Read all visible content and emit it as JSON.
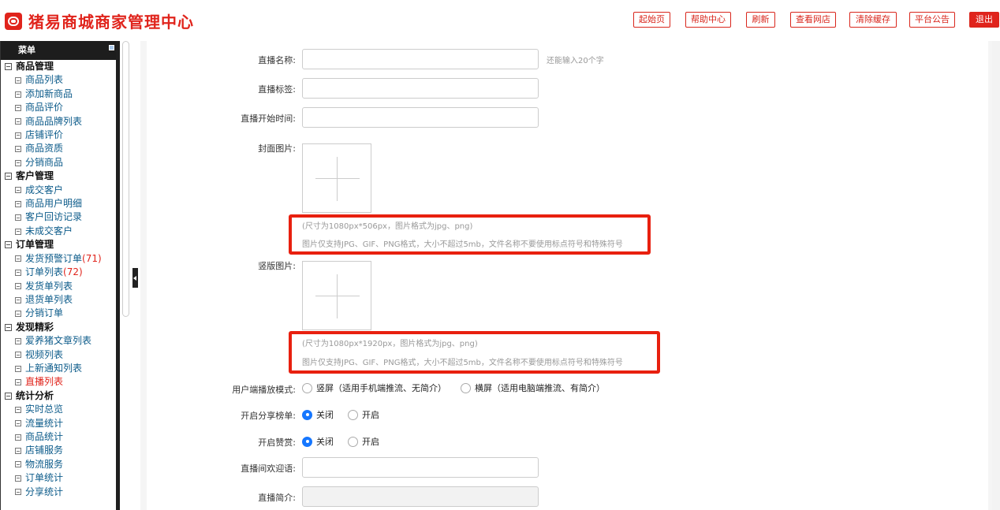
{
  "app": {
    "title": "猪易商城商家管理中心",
    "brand_color": "#e0241c"
  },
  "topnav": {
    "start": "起始页",
    "help": "帮助中心",
    "refresh": "刷新",
    "view_shop": "查看网店",
    "clear_cache": "清除缓存",
    "announcement": "平台公告",
    "logout": "退出"
  },
  "sidebar": {
    "header": "菜单",
    "groups": [
      {
        "title": "商品管理",
        "items": [
          {
            "label": "商品列表"
          },
          {
            "label": "添加新商品"
          },
          {
            "label": "商品评价"
          },
          {
            "label": "商品品牌列表"
          },
          {
            "label": "店铺评价"
          },
          {
            "label": "商品资质"
          },
          {
            "label": "分销商品"
          }
        ]
      },
      {
        "title": "客户管理",
        "items": [
          {
            "label": "成交客户"
          },
          {
            "label": "商品用户明细"
          },
          {
            "label": "客户回访记录"
          },
          {
            "label": "未成交客户"
          }
        ]
      },
      {
        "title": "订单管理",
        "items": [
          {
            "label": "发货预警订单",
            "count": "(71)"
          },
          {
            "label": "订单列表",
            "count": "(72)"
          },
          {
            "label": "发货单列表"
          },
          {
            "label": "退货单列表"
          },
          {
            "label": "分销订单"
          }
        ]
      },
      {
        "title": "发现精彩",
        "items": [
          {
            "label": "爱养猪文章列表"
          },
          {
            "label": "视频列表"
          },
          {
            "label": "上新通知列表"
          },
          {
            "label": "直播列表",
            "active": true
          }
        ]
      },
      {
        "title": "统计分析",
        "items": [
          {
            "label": "实时总览"
          },
          {
            "label": "流量统计"
          },
          {
            "label": "商品统计"
          },
          {
            "label": "店铺服务"
          },
          {
            "label": "物流服务"
          },
          {
            "label": "订单统计"
          },
          {
            "label": "分享统计"
          }
        ]
      }
    ]
  },
  "form": {
    "name_label": "直播名称:",
    "name_value": "",
    "name_hint": "还能输入20个字",
    "tag_label": "直播标签:",
    "tag_value": "",
    "start_label": "直播开始时间:",
    "start_value": "",
    "cover_label": "封面图片:",
    "cover_hint_size": "(尺寸为1080px*506px，图片格式为jpg、png)",
    "cover_hint_rules": "图片仅支持JPG、GIF、PNG格式，大小不超过5mb，文件名称不要使用标点符号和特殊符号",
    "vertical_label": "竖版图片:",
    "vertical_hint_size": "(尺寸为1080px*1920px，图片格式为jpg、png)",
    "vertical_hint_rules": "图片仅支持JPG、GIF、PNG格式，大小不超过5mb，文件名称不要使用标点符号和特殊符号",
    "mode_label": "用户端播放模式:",
    "mode_options": [
      "竖屏（适用手机端推流、无简介）",
      "横屏（适用电脑端推流、有简介）"
    ],
    "mode_selected": null,
    "share_label": "开启分享榜单:",
    "share_options": [
      "关闭",
      "开启"
    ],
    "share_selected": "关闭",
    "reward_label": "开启赞赏:",
    "reward_options": [
      "关闭",
      "开启"
    ],
    "reward_selected": "关闭",
    "welcome_label": "直播间欢迎语:",
    "welcome_value": "",
    "intro_label": "直播简介:",
    "intro_value": ""
  }
}
